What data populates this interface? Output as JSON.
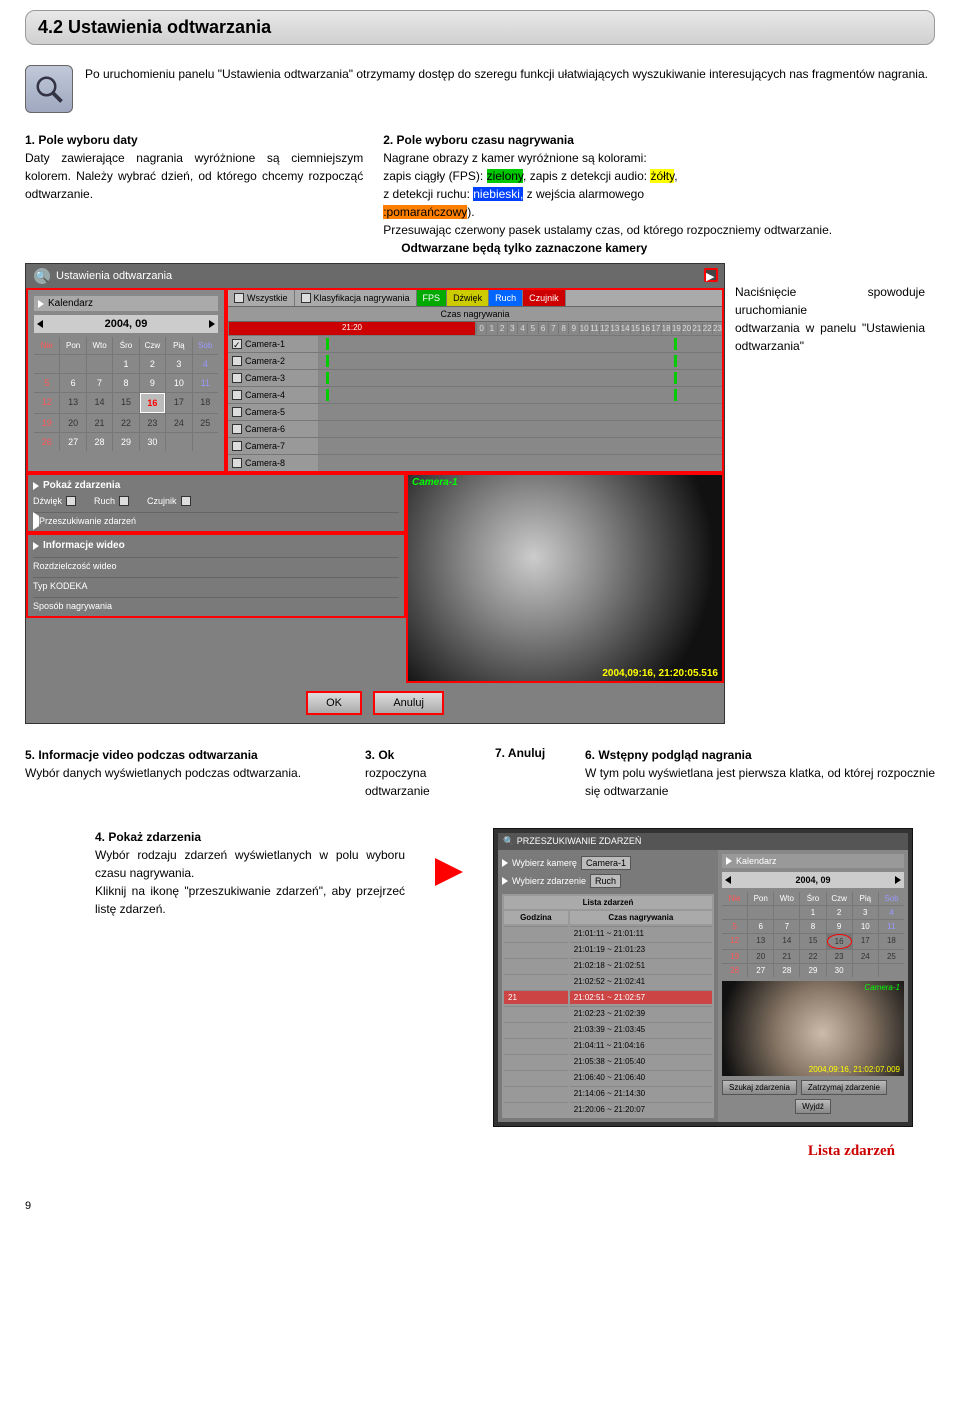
{
  "section_title": "4.2 Ustawienia odtwarzania",
  "intro": "Po uruchomieniu panelu \"Ustawienia odtwarzania\" otrzymamy dostęp do szeregu funkcji ułatwiających wyszukiwanie interesujących nas fragmentów nagrania.",
  "note1": {
    "title": "1. Pole wyboru daty",
    "body": "Daty zawierające nagrania wyróżnione są ciemniejszym kolorem. Należy wybrać dzień, od którego chcemy rozpocząć odtwarzanie."
  },
  "note2": {
    "title": "2. Pole wyboru czasu nagrywania",
    "line1": "Nagrane obrazy z kamer wyróżnione są kolorami:",
    "line2a": "zapis ciągły (FPS): ",
    "green": "zielony",
    "line2b": ", zapis z detekcji audio: ",
    "yellow": "żółty",
    "line2c": ",",
    "line3a": "z  detekcji  ruchu:  ",
    "blue": "niebieski,",
    "line3b": "  z  wejścia  alarmowego",
    "orange": ":pomarańczowy",
    "line3c": ").",
    "line4": "Przesuwając  czerwony  pasek  ustalamy  czas,  od  którego rozpoczniemy odtwarzanie.",
    "line5": "Odtwarzane będą tylko zaznaczone kamery"
  },
  "screenshot1": {
    "title": "Ustawienia odtwarzania",
    "calendar": {
      "title": "Kalendarz",
      "month": "2004, 09",
      "dow": [
        "Nie",
        "Pon",
        "Wto",
        "Śro",
        "Czw",
        "Pią",
        "Sob"
      ],
      "rows": [
        [
          "",
          "",
          "",
          "1",
          "2",
          "3",
          "4"
        ],
        [
          "5",
          "6",
          "7",
          "8",
          "9",
          "10",
          "11"
        ],
        [
          "12",
          "13",
          "14",
          "15",
          "16",
          "17",
          "18"
        ],
        [
          "19",
          "20",
          "21",
          "22",
          "23",
          "24",
          "25"
        ],
        [
          "26",
          "27",
          "28",
          "29",
          "30",
          "",
          ""
        ]
      ],
      "selected": "16"
    },
    "tabs": {
      "all": "Wszystkie",
      "klas": "Klasyfikacja nagrywania",
      "fps": "FPS",
      "aud": "Dźwięk",
      "mot": "Ruch",
      "alm": "Czujnik"
    },
    "czas": "Czas nagrywania",
    "redmark": "21:20",
    "hours": [
      "0",
      "1",
      "2",
      "3",
      "4",
      "5",
      "6",
      "7",
      "8",
      "9",
      "10",
      "11",
      "12",
      "13",
      "14",
      "15",
      "16",
      "17",
      "18",
      "19",
      "20",
      "21",
      "22",
      "23"
    ],
    "cameras": [
      "Camera-1",
      "Camera-2",
      "Camera-3",
      "Camera-4",
      "Camera-5",
      "Camera-6",
      "Camera-7",
      "Camera-8"
    ],
    "pokaz": {
      "title": "Pokaż zdarzenia",
      "aud": "Dźwięk",
      "mot": "Ruch",
      "alm": "Czujnik",
      "prz": "Przeszukiwanie zdarzeń"
    },
    "info": {
      "title": "Informacje wideo",
      "res": "Rozdzielczość wideo",
      "codec": "Typ KODEKA",
      "method": "Sposób nagrywania"
    },
    "preview": {
      "label": "Camera-1",
      "ts": "2004,09:16, 21:20:05.516"
    },
    "ok": "OK",
    "cancel": "Anuluj"
  },
  "side_note": {
    "a": "Naciśnięcie   spowoduje uruchomianie",
    "b": "odtwarzania  w  panelu \"Ustawienia odtwarzania\""
  },
  "note5": {
    "title": "5. Informacje video podczas odtwarzania",
    "body": "Wybór  danych  wyświetlanych  podczas odtwarzania."
  },
  "note3": {
    "title": "3. Ok",
    "body": "rozpoczyna odtwarzanie"
  },
  "note7": "7. Anuluj",
  "note6": {
    "title": "6. Wstępny podgląd nagrania",
    "body": "W  tym  polu  wyświetlana  jest  pierwsza klatka, od której rozpocznie się odtwarzanie"
  },
  "note4": {
    "title": "4. Pokaż zdarzenia",
    "body": "Wybór rodzaju zdarzeń wyświetlanych w polu wyboru czasu nagrywania.",
    "body2": "Kliknij na ikonę \"przeszukiwanie zdarzeń\", aby przejrzeć listę zdarzeń."
  },
  "events": {
    "title": "PRZESZUKIWANIE ZDARZEŃ",
    "wyb_kam": "Wybierz kamerę",
    "cam": "Camera-1",
    "wyb_zd": "Wybierz zdarzenie",
    "ruch": "Ruch",
    "lista": "Lista zdarzeń",
    "godz": "Godzina",
    "czas": "Czas nagrywania",
    "rows": [
      "21:01:11 ~ 21:01:11",
      "21:01:19 ~ 21:01:23",
      "21:02:18 ~ 21:02:51",
      "21:02:52 ~ 21:02:41",
      "",
      "21:02:23 ~ 21:02:39",
      "21:03:39 ~ 21:03:45",
      "21:04:11 ~ 21:04:16",
      "21:05:38 ~ 21:05:40",
      "21:06:40 ~ 21:06:40",
      "21:14:06 ~ 21:14:30",
      "21:20:06 ~ 21:20:07"
    ],
    "selrow": "21:02:51 ~ 21:02:57",
    "selg": "21",
    "cal": {
      "title": "Kalendarz",
      "month": "2004, 09",
      "dow": [
        "Nie",
        "Pon",
        "Wto",
        "Śro",
        "Czw",
        "Pią",
        "Sob"
      ],
      "rows": [
        [
          "",
          "",
          "",
          "1",
          "2",
          "3",
          "4"
        ],
        [
          "5",
          "6",
          "7",
          "8",
          "9",
          "10",
          "11"
        ],
        [
          "12",
          "13",
          "14",
          "15",
          "16",
          "17",
          "18"
        ],
        [
          "19",
          "20",
          "21",
          "22",
          "23",
          "24",
          "25"
        ],
        [
          "26",
          "27",
          "28",
          "29",
          "30",
          "",
          ""
        ]
      ],
      "circled": "16"
    },
    "preview": {
      "label": "Camera-1",
      "ts": "2004,09:16, 21:02:07.009"
    },
    "szukaj": "Szukaj zdarzenia",
    "zatrz": "Zatrzymaj zdarzenie",
    "wyjdz": "Wyjdź"
  },
  "lista_label": "Lista zdarzeń",
  "page": "9"
}
